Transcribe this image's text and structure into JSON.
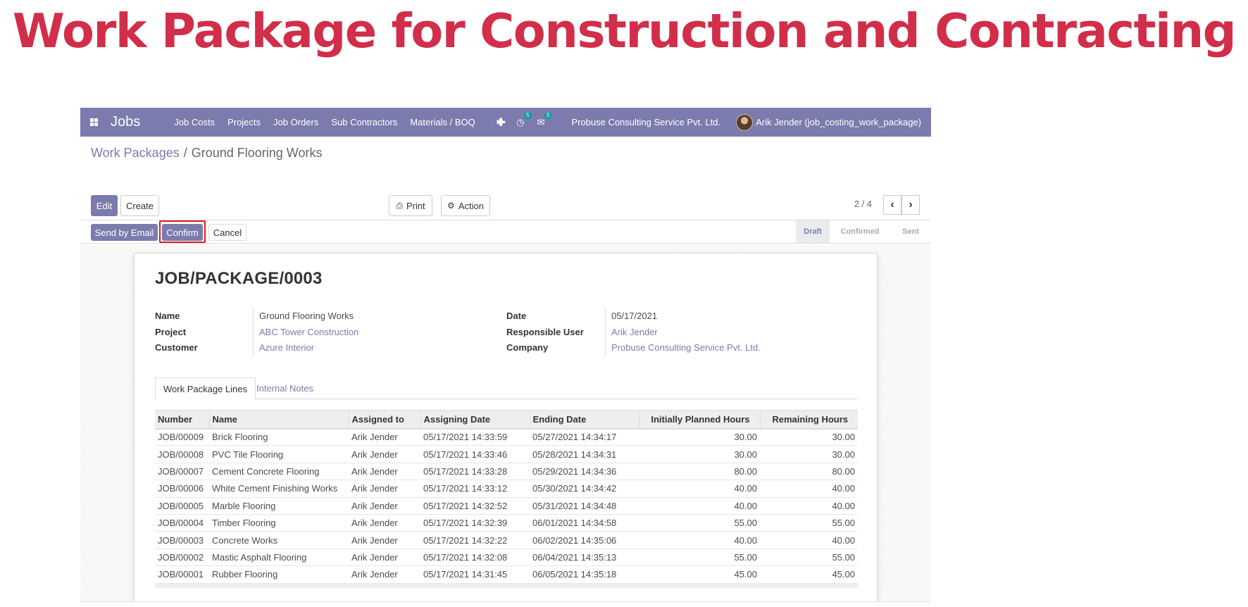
{
  "headline": "Work Package for Construction and Contracting",
  "navbar": {
    "brand": "Jobs",
    "menu": [
      "Job Costs",
      "Projects",
      "Job Orders",
      "Sub Contractors",
      "Materials / BOQ"
    ],
    "activity_badge": "5",
    "messages_badge": "5",
    "company": "Probuse Consulting Service Pvt. Ltd.",
    "user": "Arik Jender (job_costing_work_package)"
  },
  "breadcrumb": {
    "parent": "Work Packages",
    "separator": "/",
    "current": "Ground Flooring Works"
  },
  "buttons": {
    "edit": "Edit",
    "create": "Create",
    "print": "Print",
    "action": "Action"
  },
  "pager": {
    "value": "2 / 4"
  },
  "statusbar": {
    "send_email": "Send by Email",
    "confirm": "Confirm",
    "cancel": "Cancel",
    "stages": [
      "Draft",
      "Confirmed",
      "Sent"
    ],
    "current_stage": "Draft"
  },
  "record": {
    "title": "JOB/PACKAGE/0003",
    "labels": {
      "name": "Name",
      "project": "Project",
      "customer": "Customer",
      "date": "Date",
      "responsible_user": "Responsible User",
      "company": "Company"
    },
    "name": "Ground Flooring Works",
    "project": "ABC Tower Construction",
    "customer": "Azure Interior",
    "date": "05/17/2021",
    "responsible_user": "Arik Jender",
    "company": "Probuse Consulting Service Pvt. Ltd."
  },
  "tabs": [
    "Work Package Lines",
    "Internal Notes"
  ],
  "table": {
    "columns": [
      "Number",
      "Name",
      "Assigned to",
      "Assigning Date",
      "Ending Date",
      "Initially Planned Hours",
      "Remaining Hours"
    ],
    "rows": [
      [
        "JOB/00009",
        "Brick Flooring",
        "Arik Jender",
        "05/17/2021 14:33:59",
        "05/27/2021 14:34:17",
        "30.00",
        "30.00"
      ],
      [
        "JOB/00008",
        "PVC Tile Flooring",
        "Arik Jender",
        "05/17/2021 14:33:46",
        "05/28/2021 14:34:31",
        "30.00",
        "30.00"
      ],
      [
        "JOB/00007",
        "Cement Concrete Flooring",
        "Arik Jender",
        "05/17/2021 14:33:28",
        "05/29/2021 14:34:36",
        "80.00",
        "80.00"
      ],
      [
        "JOB/00006",
        "White Cement Finishing Works",
        "Arik Jender",
        "05/17/2021 14:33:12",
        "05/30/2021 14:34:42",
        "40.00",
        "40.00"
      ],
      [
        "JOB/00005",
        "Marble Flooring",
        "Arik Jender",
        "05/17/2021 14:32:52",
        "05/31/2021 14:34:48",
        "40.00",
        "40.00"
      ],
      [
        "JOB/00004",
        "Timber Flooring",
        "Arik Jender",
        "05/17/2021 14:32:39",
        "06/01/2021 14:34:58",
        "55.00",
        "55.00"
      ],
      [
        "JOB/00003",
        "Concrete Works",
        "Arik Jender",
        "05/17/2021 14:32:22",
        "06/02/2021 14:35:06",
        "40.00",
        "40.00"
      ],
      [
        "JOB/00002",
        "Mastic Asphalt Flooring",
        "Arik Jender",
        "05/17/2021 14:32:08",
        "06/04/2021 14:35:13",
        "55.00",
        "55.00"
      ],
      [
        "JOB/00001",
        "Rubber Flooring",
        "Arik Jender",
        "05/17/2021 14:31:45",
        "06/05/2021 14:35:18",
        "45.00",
        "45.00"
      ]
    ]
  },
  "colors": {
    "brand": "#7c7bad",
    "headline": "#d12e4a",
    "highlight_box": "#e31a1a"
  }
}
